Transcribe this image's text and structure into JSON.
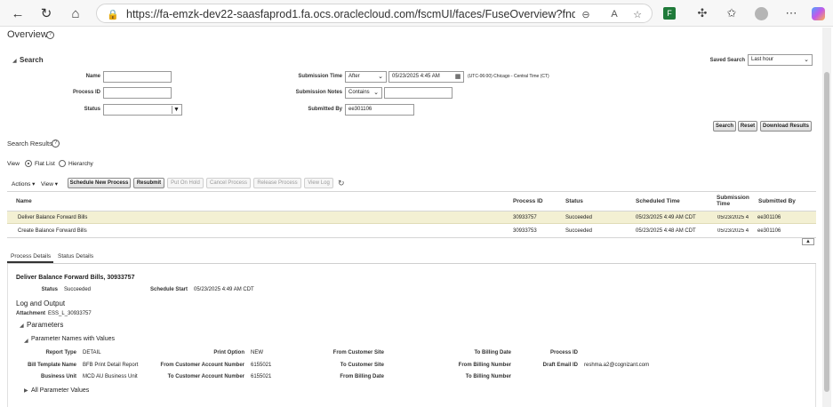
{
  "browser": {
    "url": "https://fa-emzk-dev22-saasfaprod1.fa.ocs.oraclecloud.com/fscmUI/faces/FuseOverview?fndGlobalItemNodel..."
  },
  "page": {
    "title": "Overview"
  },
  "search": {
    "heading": "Search",
    "saved_search_label": "Saved Search",
    "saved_search_value": "Last hour",
    "name_label": "Name",
    "name_value": "",
    "process_id_label": "Process ID",
    "process_id_value": "",
    "status_label": "Status",
    "status_value": "",
    "submission_time_label": "Submission Time",
    "submission_time_operator": "After",
    "submission_time_value": "05/23/2025 4:45 AM",
    "timezone_text": "(UTC-06:00) Chicago - Central Time (CT)",
    "submission_notes_label": "Submission Notes",
    "submission_notes_operator": "Contains",
    "submission_notes_value": "",
    "submitted_by_label": "Submitted By",
    "submitted_by_value": "ee301106",
    "search_button": "Search",
    "reset_button": "Reset",
    "download_button": "Download Results"
  },
  "results": {
    "heading": "Search Results",
    "view_label": "View",
    "flat_list_label": "Flat List",
    "hierarchy_label": "Hierarchy",
    "toolbar": {
      "actions": "Actions",
      "view": "View",
      "schedule_new": "Schedule New Process",
      "resubmit": "Resubmit",
      "put_on_hold": "Put On Hold",
      "cancel_process": "Cancel Process",
      "release_process": "Release Process",
      "view_log": "View Log"
    },
    "columns": {
      "name": "Name",
      "process_id": "Process ID",
      "status": "Status",
      "scheduled_time": "Scheduled Time",
      "submission_time_1": "Submission",
      "submission_time_2": "Time",
      "submitted_by": "Submitted By"
    },
    "rows": [
      {
        "name": "Deliver Balance Forward Bills",
        "process_id": "30933757",
        "status": "Succeeded",
        "scheduled_time": "05/23/2025 4:49 AM CDT",
        "submission_time": "05/23/2025 4",
        "submitted_by": "ee301106"
      },
      {
        "name": "Create Balance Forward Bills",
        "process_id": "30933753",
        "status": "Succeeded",
        "scheduled_time": "05/23/2025 4:48 AM CDT",
        "submission_time": "05/23/2025 4",
        "submitted_by": "ee301106"
      }
    ]
  },
  "details": {
    "tab_process": "Process Details",
    "tab_status": "Status Details",
    "title": "Deliver Balance Forward Bills, 30933757",
    "status_label": "Status",
    "status_value": "Succeeded",
    "schedule_start_label": "Schedule Start",
    "schedule_start_value": "05/23/2025 4:49 AM CDT",
    "log_output_heading": "Log and Output",
    "attachment_label": "Attachment",
    "attachment_value": "ESS_L_30933757",
    "parameters_heading": "Parameters",
    "param_names_heading": "Parameter Names with Values",
    "all_params_heading": "All Parameter Values",
    "params": {
      "report_type_label": "Report Type",
      "report_type_value": "DETAIL",
      "bill_template_label": "Bill Template Name",
      "bill_template_value": "BFB Print Detail Report",
      "business_unit_label": "Business Unit",
      "business_unit_value": "MCD AU Business Unit",
      "print_option_label": "Print Option",
      "print_option_value": "NEW",
      "from_cust_acct_label": "From Customer Account Number",
      "from_cust_acct_value": "6155021",
      "to_cust_acct_label": "To Customer Account Number",
      "to_cust_acct_value": "6155021",
      "from_cust_site_label": "From Customer Site",
      "to_cust_site_label": "To Customer Site",
      "from_billing_date_label": "From Billing Date",
      "to_billing_date_label": "To Billing Date",
      "from_billing_num_label": "From Billing Number",
      "to_billing_num_label": "To Billing Number",
      "process_id_label": "Process ID",
      "draft_email_label": "Draft Email ID",
      "draft_email_value": "reshma.a2@cognizant.com"
    }
  },
  "colors": {
    "selected_row": "#f3f0d3",
    "browser_chrome": "#f7f7f7"
  }
}
